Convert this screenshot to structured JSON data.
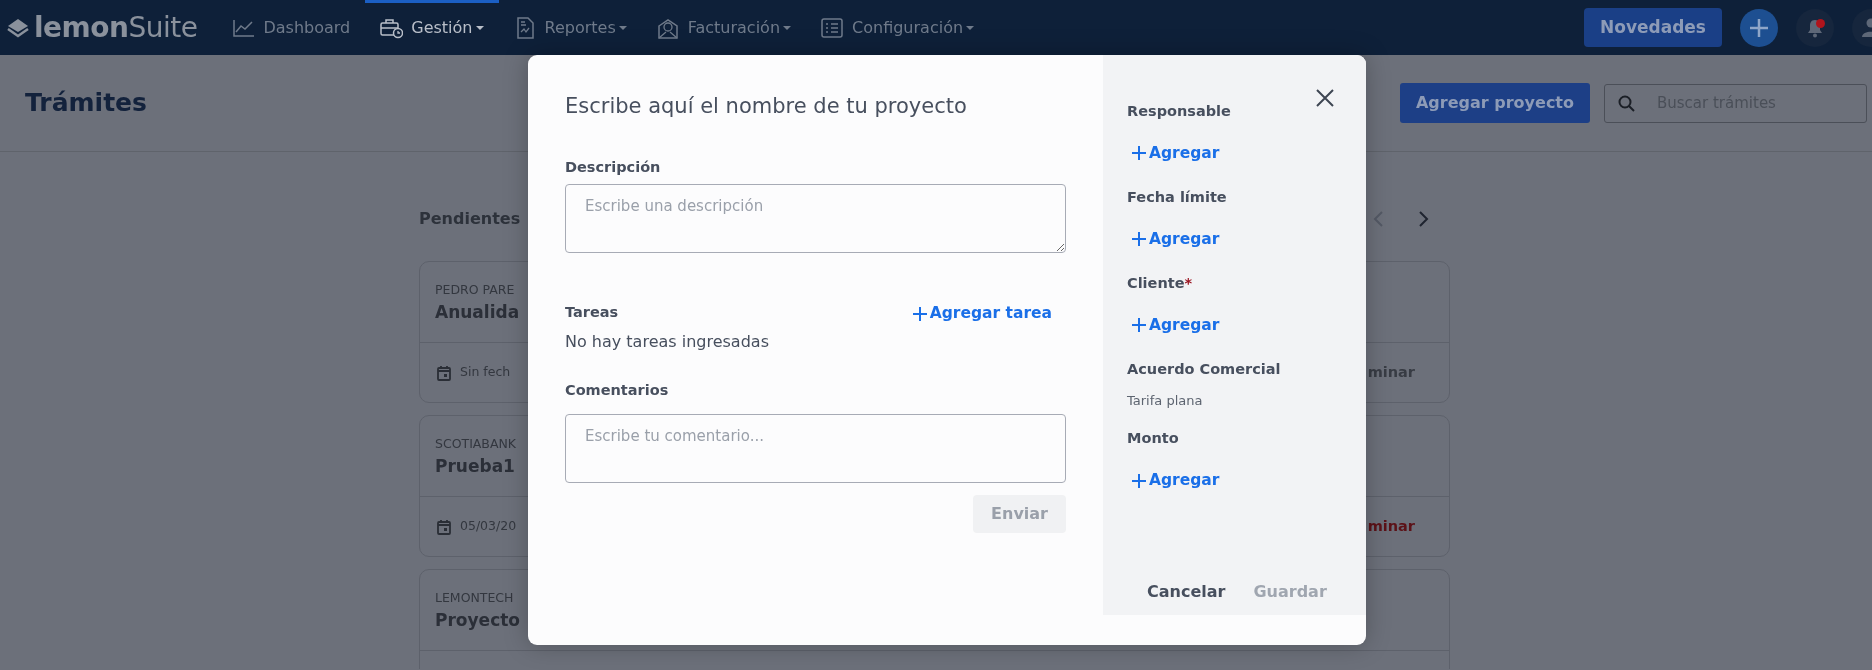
{
  "navbar": {
    "logo": "**lemon**Suite",
    "items": [
      {
        "label": "Dashboard",
        "selected": false,
        "dropdown": false
      },
      {
        "label": "Gestión",
        "selected": true,
        "dropdown": true
      },
      {
        "label": "Reportes",
        "selected": false,
        "dropdown": true
      },
      {
        "label": "Facturación",
        "selected": false,
        "dropdown": true
      },
      {
        "label": "Configuración",
        "selected": false,
        "dropdown": true
      }
    ],
    "news_button": "Novedades",
    "notifications": {
      "unread": true
    }
  },
  "header": {
    "title": "Trámites",
    "add_button": "Agregar proyecto",
    "search": {
      "placeholder": "Buscar trámites"
    }
  },
  "list": {
    "title": "Pendientes",
    "pager": {
      "prev_disabled": true,
      "next_disabled": false
    },
    "cards": [
      {
        "client": "PEDRO PARE",
        "name": "Anualida",
        "date": "Sin fech",
        "action": "minar",
        "action_disabled": true
      },
      {
        "client": "SCOTIABANK",
        "name": "Prueba1",
        "date": "05/03/20",
        "action": "minar",
        "action_disabled": false
      },
      {
        "client": "LEMONTECH",
        "name": "Proyecto"
      }
    ]
  },
  "modal": {
    "title": "Escribe aquí el nombre de tu proyecto",
    "description": {
      "label": "Descripción",
      "placeholder": "Escribe una descripción"
    },
    "tasks": {
      "label": "Tareas",
      "add_link": "Agregar tarea",
      "empty_text": "No hay tareas ingresadas"
    },
    "comments": {
      "label": "Comentarios",
      "placeholder": "Escribe tu comentario...",
      "send_button": {
        "label": "Enviar",
        "disabled": true
      }
    },
    "side_fields": [
      {
        "label": "Responsable",
        "kind": "add",
        "action": "Agregar"
      },
      {
        "label": "Fecha límite",
        "kind": "add",
        "action": "Agregar"
      },
      {
        "label": "Cliente",
        "required_mark": "*",
        "kind": "add",
        "action": "Agregar"
      },
      {
        "label": "Acuerdo Comercial",
        "kind": "text",
        "value": "Tarifa plana"
      },
      {
        "label": "Monto",
        "kind": "add",
        "action": "Agregar"
      }
    ],
    "cancel_button": {
      "label": "Cancelar",
      "disabled": false
    },
    "save_button": {
      "label": "Guardar",
      "disabled": true
    }
  }
}
